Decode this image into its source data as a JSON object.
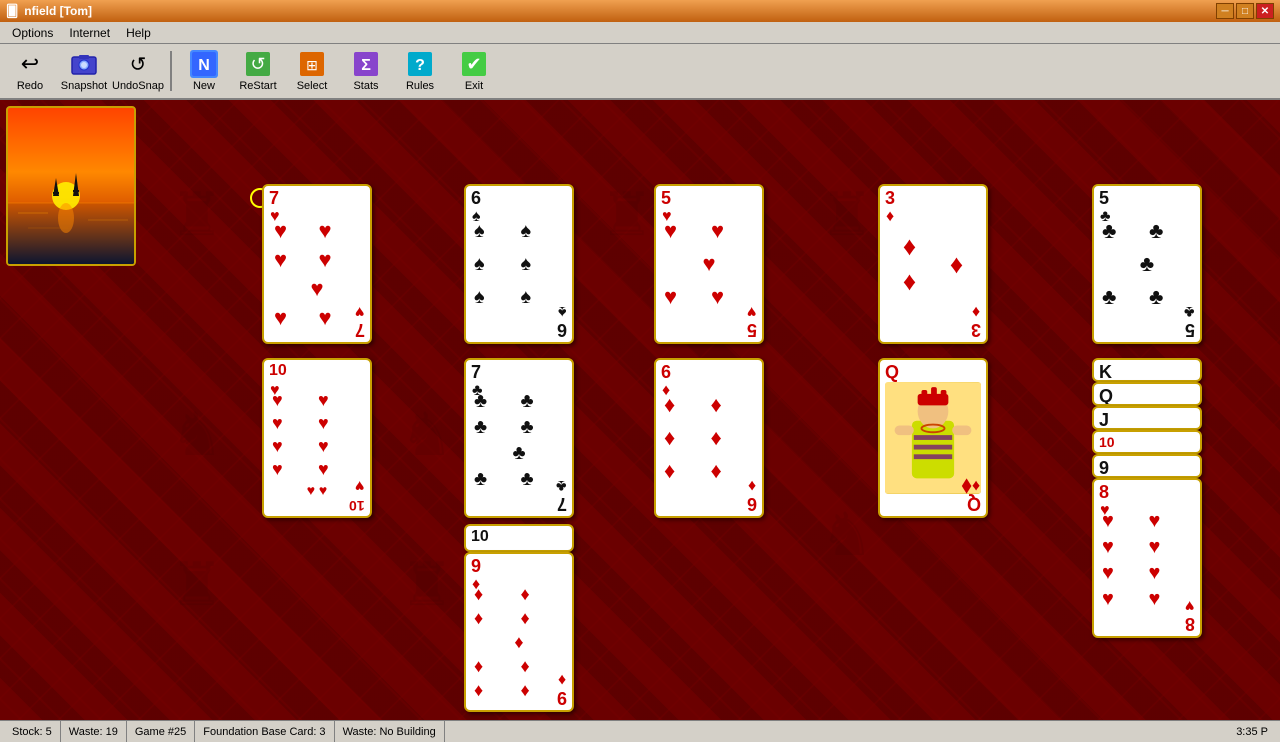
{
  "titlebar": {
    "title": "nfield [Tom]",
    "min_label": "─",
    "max_label": "□",
    "close_label": "✕"
  },
  "menubar": {
    "items": [
      "Options",
      "Internet",
      "Help"
    ]
  },
  "toolbar": {
    "buttons": [
      {
        "id": "redo",
        "label": "Redo",
        "icon": "↩"
      },
      {
        "id": "snapshot",
        "label": "Snapshot",
        "icon": "📷"
      },
      {
        "id": "undosnap",
        "label": "UndoSnap",
        "icon": "↺"
      },
      {
        "id": "new",
        "label": "New",
        "icon": "🃏"
      },
      {
        "id": "restart",
        "label": "ReStart",
        "icon": "🔄"
      },
      {
        "id": "select",
        "label": "Select",
        "icon": "⊞"
      },
      {
        "id": "stats",
        "label": "Stats",
        "icon": "Σ"
      },
      {
        "id": "rules",
        "label": "Rules",
        "icon": "?"
      },
      {
        "id": "exit",
        "label": "Exit",
        "icon": "✔"
      }
    ]
  },
  "statusbar": {
    "stock": "Stock: 5",
    "waste": "Waste: 19",
    "game": "Game #25",
    "foundation": "Foundation Base Card: 3",
    "building": "Waste: No Building",
    "time": "3:35 P"
  },
  "columns": {
    "col1": {
      "cards": [
        {
          "rank": "7",
          "suit": "♥",
          "color": "red"
        },
        {
          "rank": "10",
          "suit": "♥",
          "color": "red"
        }
      ]
    },
    "col2": {
      "cards": [
        {
          "rank": "6",
          "suit": "♠",
          "color": "black"
        },
        {
          "rank": "7",
          "suit": "♣",
          "color": "black"
        },
        {
          "rank": "10",
          "suit": "♠",
          "color": "black"
        },
        {
          "rank": "9",
          "suit": "♦",
          "color": "red"
        }
      ]
    },
    "col3": {
      "cards": [
        {
          "rank": "5",
          "suit": "♥",
          "color": "red"
        },
        {
          "rank": "6",
          "suit": "♦",
          "color": "red"
        }
      ]
    },
    "col4": {
      "cards": [
        {
          "rank": "3",
          "suit": "♦",
          "color": "red"
        },
        {
          "rank": "Q",
          "suit": "♦",
          "color": "red",
          "face": true
        }
      ]
    },
    "col5": {
      "cards": [
        {
          "rank": "5",
          "suit": "♣",
          "color": "black"
        },
        {
          "rank": "K",
          "suit": "♠",
          "color": "black"
        },
        {
          "rank": "Q",
          "suit": "♠",
          "color": "black"
        },
        {
          "rank": "J",
          "suit": "♠",
          "color": "black"
        },
        {
          "rank": "10",
          "suit": "♥",
          "color": "red"
        },
        {
          "rank": "9",
          "suit": "♠",
          "color": "black"
        },
        {
          "rank": "8",
          "suit": "♥",
          "color": "red"
        }
      ]
    }
  }
}
